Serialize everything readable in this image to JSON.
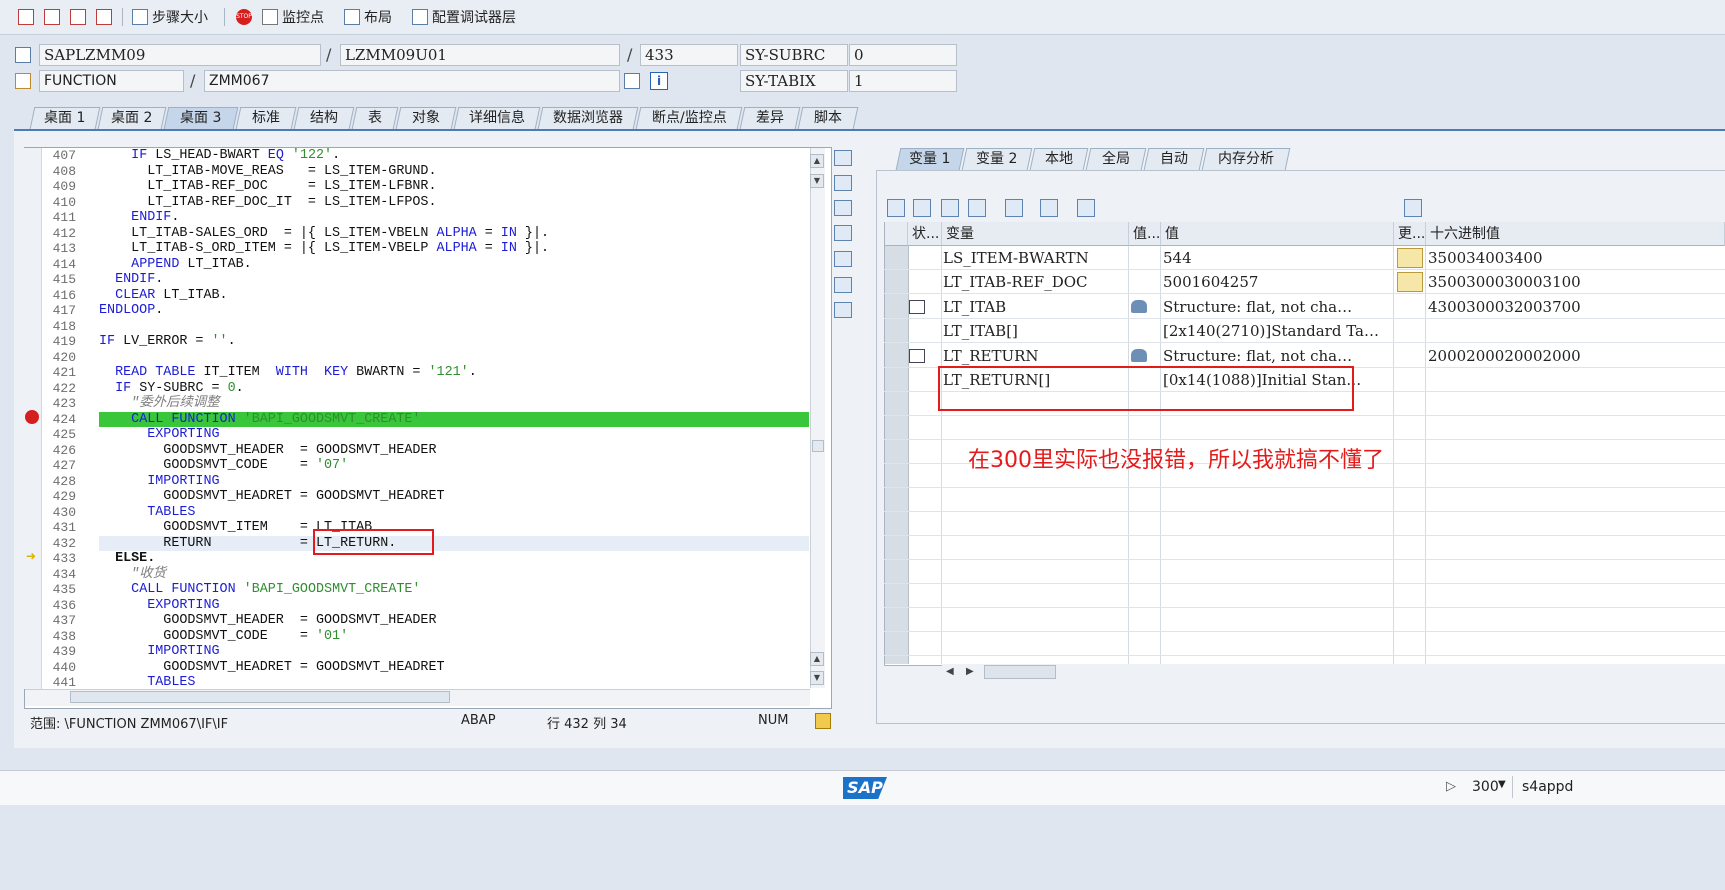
{
  "toolbar": {
    "step_size": "步骤大小",
    "watchpoint": "监控点",
    "layout": "布局",
    "config_debugger": "配置调试器层"
  },
  "header": {
    "program": "SAPLZMM09",
    "include": "LZMM09U01",
    "line_no": "433",
    "sy_subrc_label": "SY-SUBRC",
    "sy_subrc_value": "0",
    "event_type": "FUNCTION",
    "event_name": "ZMM067",
    "sy_tabix_label": "SY-TABIX",
    "sy_tabix_value": "1"
  },
  "tabs": [
    "桌面 1",
    "桌面 2",
    "桌面 3",
    "标准",
    "结构",
    "表",
    "对象",
    "详细信息",
    "数据浏览器",
    "断点/监控点",
    "差异",
    "脚本"
  ],
  "code": {
    "line_numbers": [
      "407",
      "408",
      "409",
      "410",
      "411",
      "412",
      "413",
      "414",
      "415",
      "416",
      "417",
      "418",
      "419",
      "420",
      "421",
      "422",
      "423",
      "424",
      "425",
      "426",
      "427",
      "428",
      "429",
      "430",
      "431",
      "432",
      "433",
      "434",
      "435",
      "436",
      "437",
      "438",
      "439",
      "440",
      "441"
    ],
    "comment_423": "\"委外后续调整",
    "comment_434": "\"收货"
  },
  "status_bar": {
    "scope": "范围:  \\FUNCTION ZMM067\\IF\\IF",
    "language": "ABAP",
    "position": "行 432 列 34",
    "num": "NUM"
  },
  "var_tabs": [
    "变量 1",
    "变量 2",
    "本地",
    "全局",
    "自动",
    "内存分析"
  ],
  "grid": {
    "columns": [
      "状...",
      "变量",
      "值...",
      "值",
      "更...",
      "十六进制值"
    ],
    "rows": [
      {
        "name": "LS_ITEM-BWARTN",
        "value": "544",
        "hex": "350034003400"
      },
      {
        "name": "LT_ITAB-REF_DOC",
        "value": "5001604257",
        "hex": "3500300030003100"
      },
      {
        "name": "LT_ITAB",
        "value": "Structure: flat, not cha…",
        "hex": "4300300032003700"
      },
      {
        "name": "LT_ITAB[]",
        "value": "[2x140(2710)]Standard Ta…",
        "hex": ""
      },
      {
        "name": "LT_RETURN",
        "value": "Structure: flat, not cha…",
        "hex": "2000200020002000"
      },
      {
        "name": "LT_RETURN[]",
        "value": "[0x14(1088)]Initial Stan…",
        "hex": ""
      }
    ]
  },
  "annotation": "在300里实际也没报错，所以我就搞不懂了",
  "footer": {
    "brand": "SAP",
    "client": "300",
    "server": "s4appd"
  },
  "colors": {
    "current_line": "#39c63a",
    "annotation_red": "#e31b1b",
    "keyword_blue": "#1c1cd7",
    "string_green": "#2f8f2f"
  }
}
